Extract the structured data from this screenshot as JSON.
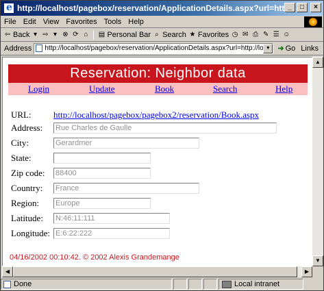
{
  "window": {
    "title": "http://localhost/pagebox/reservation/ApplicationDetails.aspx?url=http://local..."
  },
  "menu": [
    "File",
    "Edit",
    "View",
    "Favorites",
    "Tools",
    "Help"
  ],
  "toolbar": {
    "back": "Back",
    "personal_bar": "Personal Bar",
    "search": "Search",
    "favorites": "Favorites"
  },
  "address": {
    "label": "Address",
    "value": "http://localhost/pagebox/reservation/ApplicationDetails.aspx?url=http://lo",
    "go": "Go",
    "links": "Links"
  },
  "page": {
    "banner": "Reservation: Neighbor data",
    "nav": [
      "Login",
      "Update",
      "Book",
      "Search",
      "Help"
    ],
    "url_label": "URL:",
    "url_value": "http://localhost/pagebox/pagebox2/reservation/Book.aspx",
    "fields": [
      {
        "label": "Address:",
        "value": ""
      },
      {
        "label": "City:",
        "value": "Gerardmer"
      },
      {
        "label": "State:",
        "value": ""
      },
      {
        "label": "Zip code:",
        "value": "88400"
      },
      {
        "label": "Country:",
        "value": "France"
      },
      {
        "label": "Region:",
        "value": "Europe"
      },
      {
        "label": "Latitude:",
        "value": "N:46:11:111"
      },
      {
        "label": "Longitude:",
        "value": "E:6:22:222"
      }
    ],
    "address_value": "Rue Charles de Gaulle",
    "footer": "04/16/2002 00:10:42. © 2002 Alexis Grandemange"
  },
  "status": {
    "text": "Done",
    "zone": "Local intranet"
  },
  "colors": {
    "banner": "#c8141c",
    "nav_bg": "#fcc0c0",
    "link": "#0000ee",
    "footer": "#c8141c"
  }
}
